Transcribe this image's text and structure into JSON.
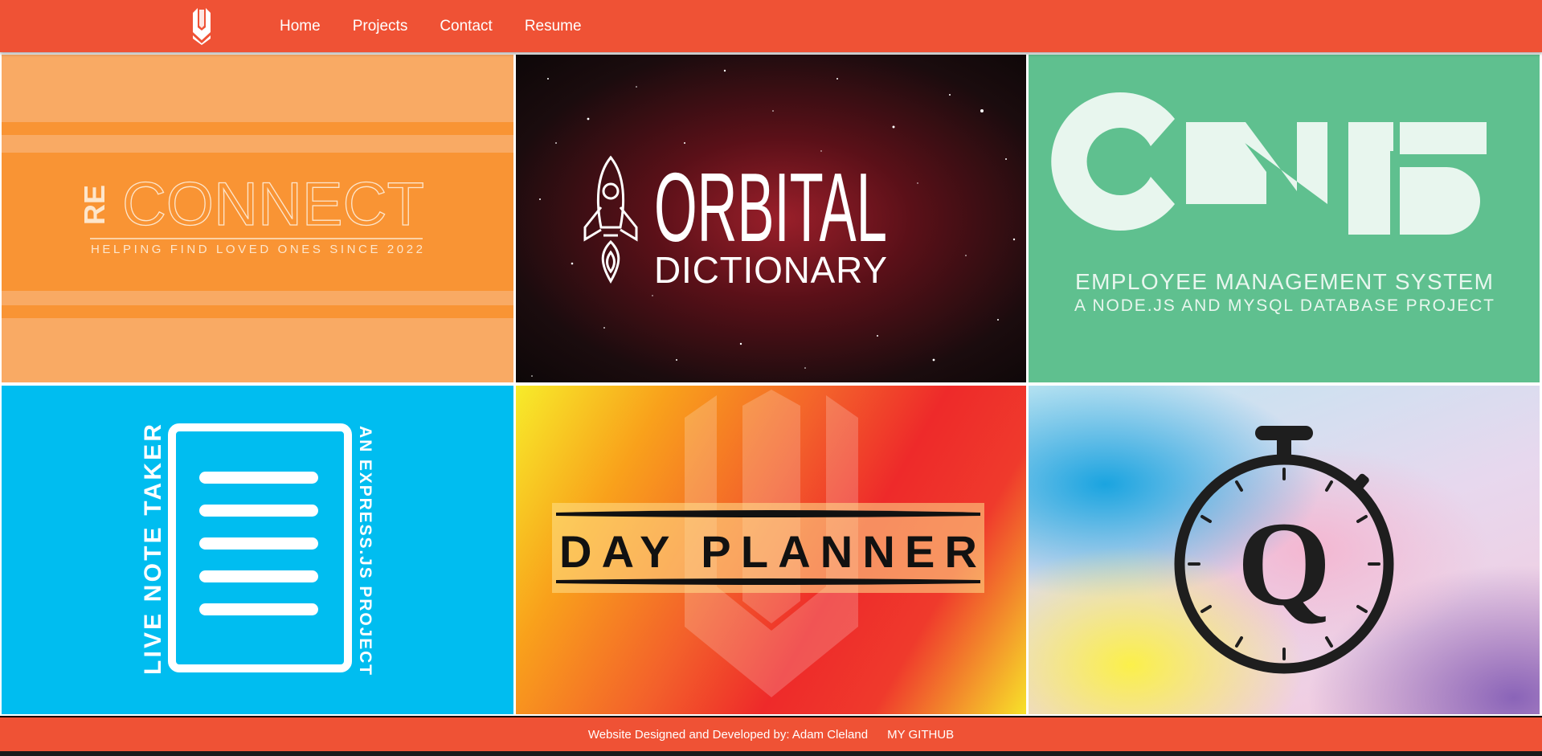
{
  "nav": {
    "logo_icon": "shield-chevron-logo-icon",
    "items": [
      "Home",
      "Projects",
      "Contact",
      "Resume"
    ]
  },
  "projects": {
    "reconnect": {
      "prefix": "RE",
      "title": "CONNECT",
      "tagline": "HELPING FIND LOVED ONES SINCE 2022"
    },
    "orbital": {
      "title": "ORBITAL",
      "subtitle": "DICTIONARY",
      "icon": "rocket-icon"
    },
    "cms": {
      "title": "CMS",
      "subtitle": "EMPLOYEE MANAGEMENT SYSTEM",
      "tagline": "A NODE.JS AND MYSQL DATABASE PROJECT"
    },
    "notetaker": {
      "left_text": "LIVE NOTE TAKER",
      "right_text": "AN EXPRESS.JS PROJECT",
      "icon": "notepad-icon"
    },
    "dayplanner": {
      "title": "DAY PLANNER"
    },
    "quiz": {
      "letter": "Q",
      "icon": "stopwatch-icon"
    }
  },
  "footer": {
    "credit": "Website Designed and Developed by: Adam Cleland",
    "github": "MY GITHUB"
  },
  "colors": {
    "accent": "#ef5235",
    "reconnect_bg": "#f9aa64",
    "cms_bg": "#5fc08f",
    "notetaker_bg": "#00bdf0"
  }
}
